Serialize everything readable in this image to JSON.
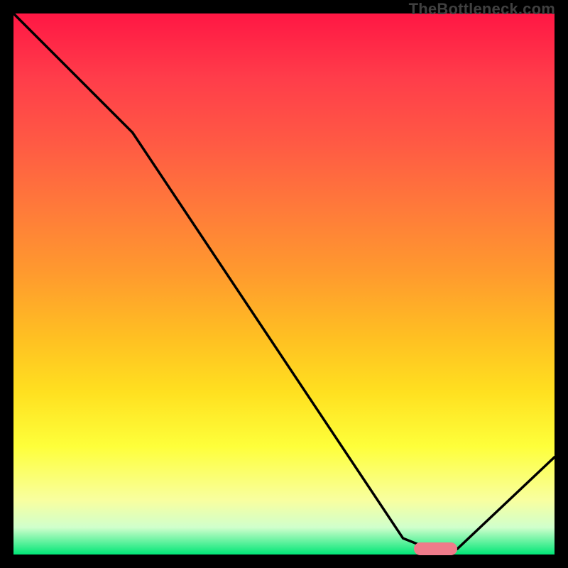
{
  "watermark": "TheBottleneck.com",
  "chart_data": {
    "type": "line",
    "title": "",
    "xlabel": "",
    "ylabel": "",
    "xlim": [
      0,
      100
    ],
    "ylim": [
      0,
      100
    ],
    "x": [
      0,
      22,
      72,
      77,
      82,
      100
    ],
    "values": [
      100,
      78,
      3,
      1,
      1,
      18
    ],
    "notes": "V-shaped curve over red→yellow→green gradient; minimum plateau at x≈77–82",
    "optimum_marker": {
      "x_start": 74,
      "x_end": 82,
      "y": 1
    },
    "gradient_stops": [
      {
        "pct": 0,
        "color": "#ff1744"
      },
      {
        "pct": 12,
        "color": "#ff3d4a"
      },
      {
        "pct": 24,
        "color": "#ff5a44"
      },
      {
        "pct": 36,
        "color": "#ff7a3a"
      },
      {
        "pct": 48,
        "color": "#ff9a2e"
      },
      {
        "pct": 60,
        "color": "#ffc022"
      },
      {
        "pct": 70,
        "color": "#ffe020"
      },
      {
        "pct": 80,
        "color": "#feff3a"
      },
      {
        "pct": 90,
        "color": "#f8ffa0"
      },
      {
        "pct": 95,
        "color": "#d0ffcc"
      },
      {
        "pct": 100,
        "color": "#00e676"
      }
    ]
  }
}
